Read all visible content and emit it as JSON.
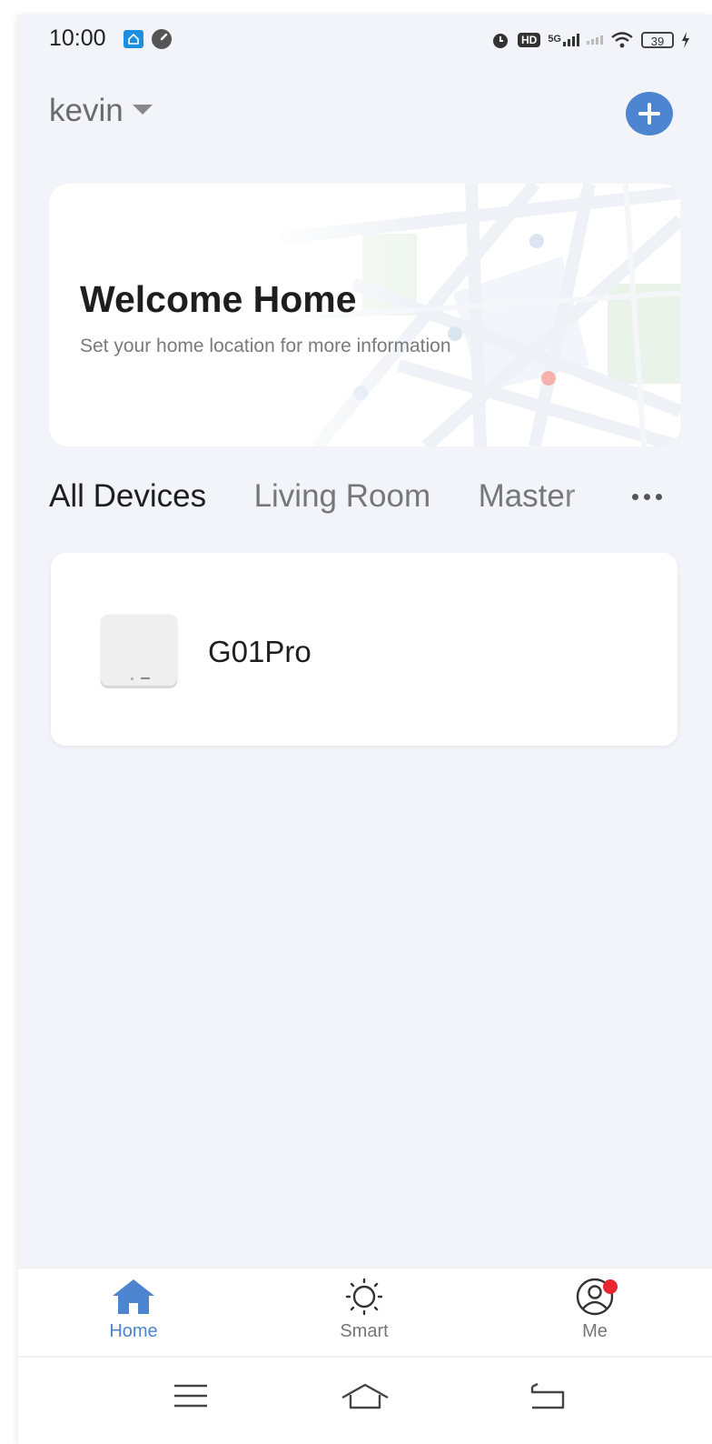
{
  "status_bar": {
    "time": "10:00",
    "network": "5G",
    "hd": "HD",
    "battery": "39"
  },
  "header": {
    "home_name": "kevin"
  },
  "welcome_card": {
    "title": "Welcome Home",
    "subtitle": "Set your home location for more information"
  },
  "tabs": {
    "items": [
      {
        "label": "All Devices",
        "active": true
      },
      {
        "label": "Living Room",
        "active": false
      },
      {
        "label": "Master",
        "active": false
      }
    ]
  },
  "devices": [
    {
      "name": "G01Pro"
    }
  ],
  "bottom_nav": {
    "items": [
      {
        "label": "Home",
        "icon": "home-icon",
        "active": true
      },
      {
        "label": "Smart",
        "icon": "sun-icon",
        "active": false
      },
      {
        "label": "Me",
        "icon": "profile-icon",
        "active": false,
        "badge": true
      }
    ]
  },
  "colors": {
    "accent": "#4d85d1",
    "background": "#f3f4f9",
    "badge": "#e8262f"
  }
}
